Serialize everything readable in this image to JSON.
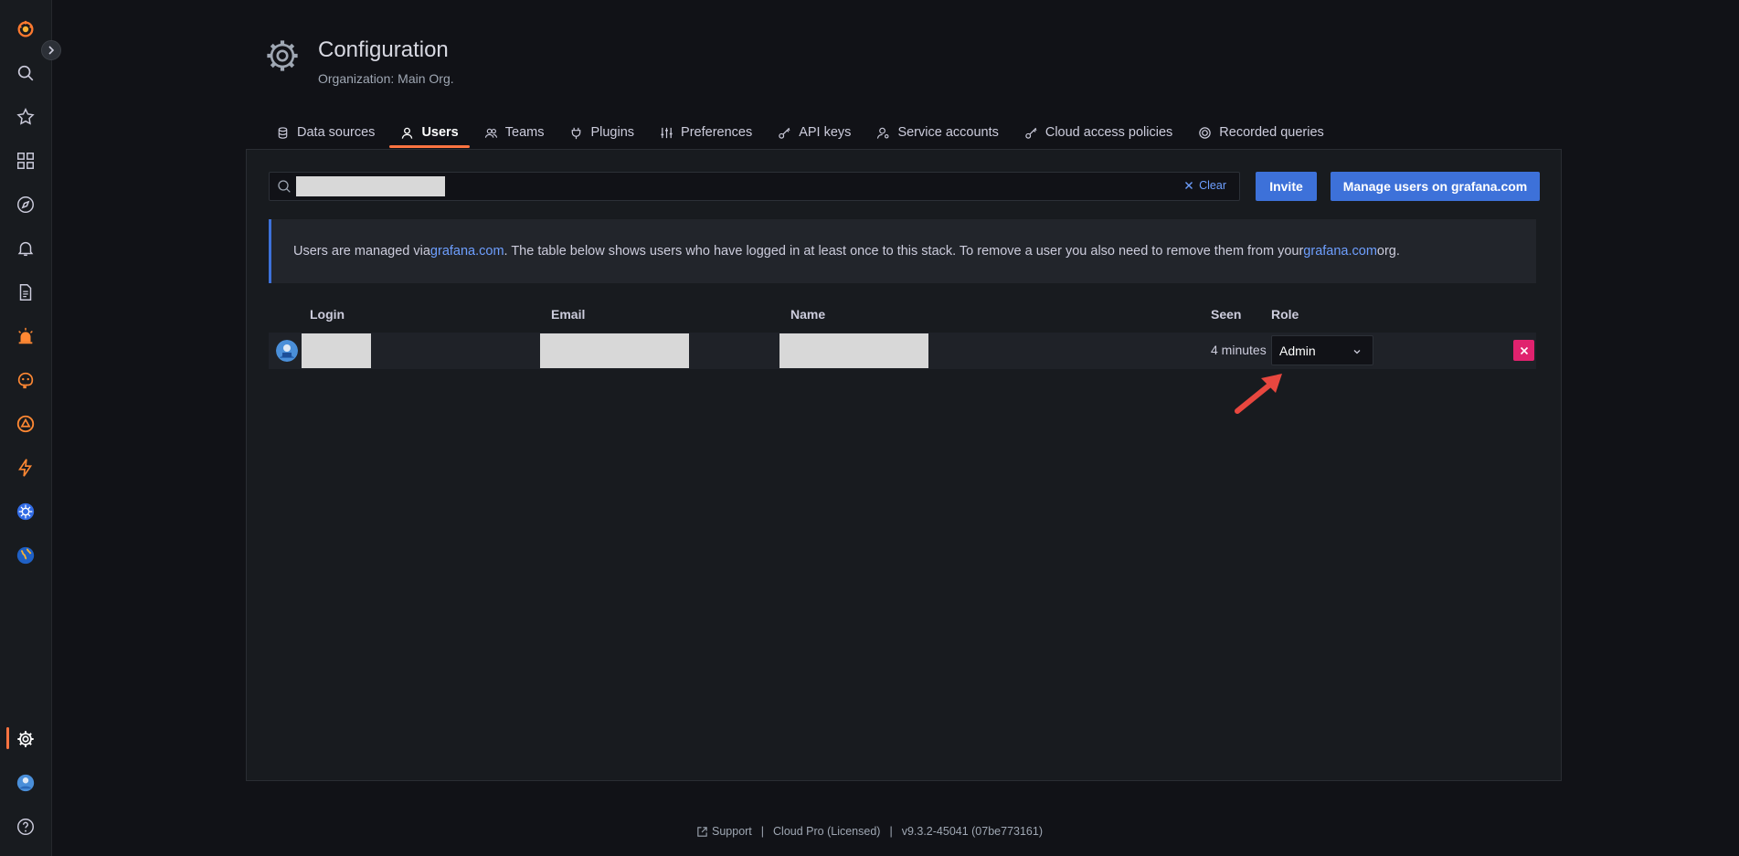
{
  "header": {
    "title": "Configuration",
    "subtitle": "Organization: Main Org."
  },
  "tabs": [
    {
      "label": "Data sources",
      "icon": "database-icon"
    },
    {
      "label": "Users",
      "icon": "user-icon",
      "active": true
    },
    {
      "label": "Teams",
      "icon": "users-icon"
    },
    {
      "label": "Plugins",
      "icon": "plug-icon"
    },
    {
      "label": "Preferences",
      "icon": "sliders-icon"
    },
    {
      "label": "API keys",
      "icon": "key-icon"
    },
    {
      "label": "Service accounts",
      "icon": "user-cog-icon"
    },
    {
      "label": "Cloud access policies",
      "icon": "key-icon"
    },
    {
      "label": "Recorded queries",
      "icon": "record-icon"
    }
  ],
  "search": {
    "placeholder": "",
    "clear_label": "Clear"
  },
  "actions": {
    "invite_label": "Invite",
    "manage_label": "Manage users on grafana.com"
  },
  "info": {
    "text_1": "Users are managed via ",
    "link_1": "grafana.com",
    "text_2": ". The table below shows users who have logged in at least once to this stack. To remove a user you also need to remove them from your ",
    "link_2": "grafana.com",
    "text_3": " org."
  },
  "table": {
    "columns": [
      "Login",
      "Email",
      "Name",
      "Seen",
      "Role"
    ],
    "rows": [
      {
        "login": "",
        "email": "",
        "name": "",
        "seen": "4 minutes",
        "role": "Admin"
      }
    ]
  },
  "footer": {
    "support": "Support",
    "license": "Cloud Pro (Licensed)",
    "version": "v9.3.2-45041 (07be773161)"
  },
  "colors": {
    "accent": "#ff7441",
    "primary": "#3d71d9",
    "link": "#6e9fff",
    "danger": "#e0226e",
    "annotation_arrow": "#e8473f"
  }
}
